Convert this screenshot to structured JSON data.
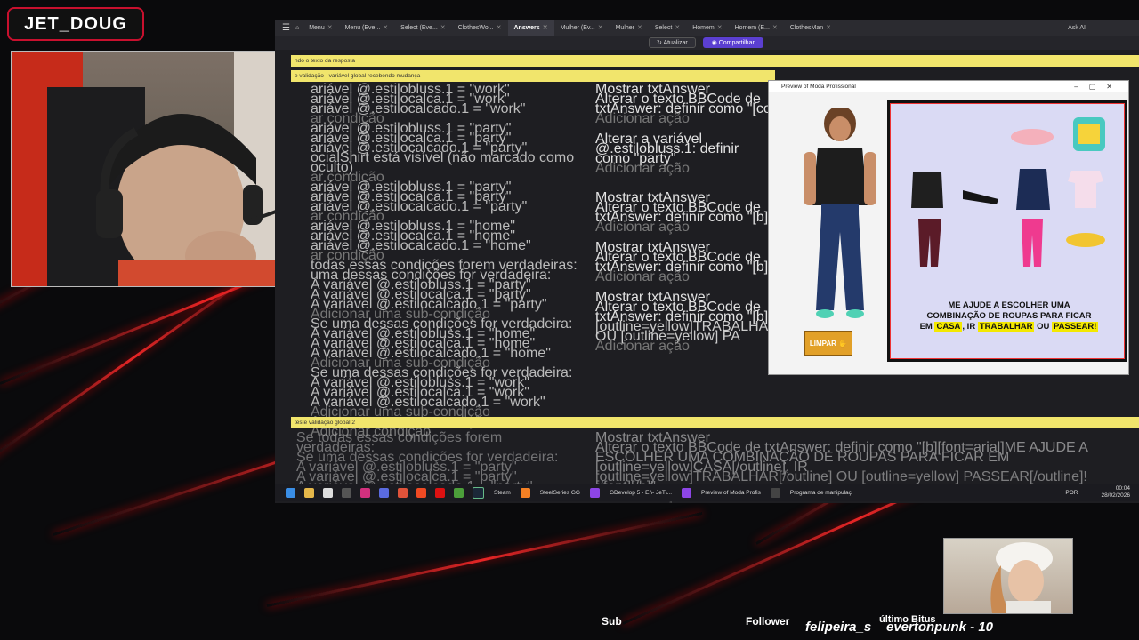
{
  "overlay": {
    "channel_name": "JET_DOUG"
  },
  "editor": {
    "tabs": [
      {
        "label": "Menu",
        "active": false
      },
      {
        "label": "Menu (Eve...",
        "active": false
      },
      {
        "label": "Select (Eve...",
        "active": false
      },
      {
        "label": "ClothesWo...",
        "active": false
      },
      {
        "label": "Answers",
        "active": true
      },
      {
        "label": "Mulher (Ev...",
        "active": false
      },
      {
        "label": "Mulher",
        "active": false
      },
      {
        "label": "Select",
        "active": false
      },
      {
        "label": "Homem",
        "active": false
      },
      {
        "label": "Homem (E...",
        "active": false
      },
      {
        "label": "ClothesMan",
        "active": false
      }
    ],
    "ask_ai": "Ask AI",
    "update_label": "Atualizar",
    "share_label": "Compartilhar",
    "header_bar": "ndo o texto da resposta",
    "subheader_bar": "e validação - variável global recebendo mudança",
    "global2_bar": "teste validação global 2"
  },
  "conditions": [
    "ariável @.estilobluss.1 = \"work\"",
    "ariável @.estilocalca.1 = \"work\"",
    "ariável @.estilocalcado.1 = \"work\"",
    "ar condição",
    "ariável @.estilobluss.1 = \"party\"",
    "ariável @.estilocalca.1 = \"party\"",
    "ariável @.estilocalcado.1 = \"party\"",
    "ocialShirt está visível (não marcado como oculto)",
    "ar condição",
    "ariável @.estilobluss.1 = \"party\"",
    "ariável @.estilocalca.1 = \"party\"",
    "ariável @.estilocalcado.1 = \"party\"",
    "ar condição",
    "ariável @.estilobluss.1 = \"home\"",
    "ariável @.estilocalca.1 = \"home\"",
    "ariável @.estilocalcado.1 = \"home\"",
    "ar condição",
    "todas essas condições forem verdadeiras:",
    "uma dessas condições for verdadeira:",
    "A variável @.estilobluss.1 = \"party\"",
    "A variável @.estilocalca.1 = \"party\"",
    "A variável @.estilocalcado.1 = \"party\"",
    "Adicionar uma sub-condição",
    "Se uma dessas condições for verdadeira:",
    "A variável @.estilobluss.1 = \"home\"",
    "A variável @.estilocalca.1 = \"home\"",
    "A variável @.estilocalcado.1 = \"home\"",
    "Adicionar uma sub-condição",
    "Se uma dessas condições for verdadeira:",
    "A variável @.estilobluss.1 = \"work\"",
    "A variável @.estilocalca.1 = \"work\"",
    "A variável @.estilocalcado.1 = \"work\"",
    "Adicionar uma sub-condição",
    "Adicionar uma sub-condição",
    "Adicionar condição"
  ],
  "actions": [
    "Mostrar txtAnswer",
    "Alterar o texto BBCode de txtAnswer: definir como \"[co",
    "Adicionar ação",
    "Alterar a variável @.estilobluss.1: definir como \"party\"",
    "Adicionar ação",
    "Mostrar txtAnswer",
    "Alterar o texto BBCode de txtAnswer: definir como \"[b][",
    "Adicionar ação",
    "Mostrar txtAnswer",
    "Alterar o texto BBCode de txtAnswer: definir como \"[b][",
    "Adicionar ação",
    "Mostrar txtAnswer",
    "Alterar o texto BBCode de txtAnswer: definir como \"[b][",
    "[outline=yellow]TRABALHAR[/outline] OU [outline=yellow] PA",
    "Adicionar ação"
  ],
  "bottom_event": {
    "conditions": [
      "Se todas essas condições forem verdadeiras:",
      "Se uma dessas condições for verdadeira:",
      "A variável @.estilobluss.1 = \"party\"",
      "A variável @.estilocalca.1 = \"party\"",
      "A variável @.estilocalcado.1 = \"party\""
    ],
    "actions": [
      "Mostrar txtAnswer",
      "Alterar o texto BBCode de txtAnswer: definir como \"[b][font=arial]ME AJUDE A ESCOLHER UMA COMBINAÇÃO DE ROUPAS PARA FICAR EM [outline=yellow]CASA[/outline], IR",
      "[outline=yellow]TRABALHAR[/outline] OU [outline=yellow] PASSEAR[/outline]![/font][/b]\"",
      "Adicionar ação"
    ]
  },
  "preview": {
    "window_title": "Preview of Moda Profissional",
    "message_line1": "ME AJUDE A ESCOLHER UMA",
    "message_line2": "COMBINAÇÃO DE ROUPAS PARA FICAR",
    "message_em": "EM",
    "message_casa": "CASA",
    "message_ir": ", IR",
    "message_trabalhar": "TRABALHAR",
    "message_ou": "OU",
    "message_passear": "PASSEAR!",
    "clear_button": "LIMPAR"
  },
  "taskbar": {
    "items": [
      "Steam",
      "SteelSeries GG",
      "GDevelop 5 - E:\\- JeT\\...",
      "Preview of Moda Profis",
      "Programa de manipulaç"
    ],
    "lang": "POR",
    "time": "00:04",
    "date": "28/02/2026"
  },
  "stream_bar": {
    "sub_label": "Sub",
    "follower_label": "Follower",
    "follower_name": "felipeira_s",
    "bits_label": "último Bitus",
    "bits_name": "evertonpunk - 10"
  },
  "colors": {
    "accent_red": "#c8102e",
    "yellow_bar": "#f1e56c",
    "share_purple": "#5b3fd1",
    "highlight_yellow": "#f3e800"
  }
}
